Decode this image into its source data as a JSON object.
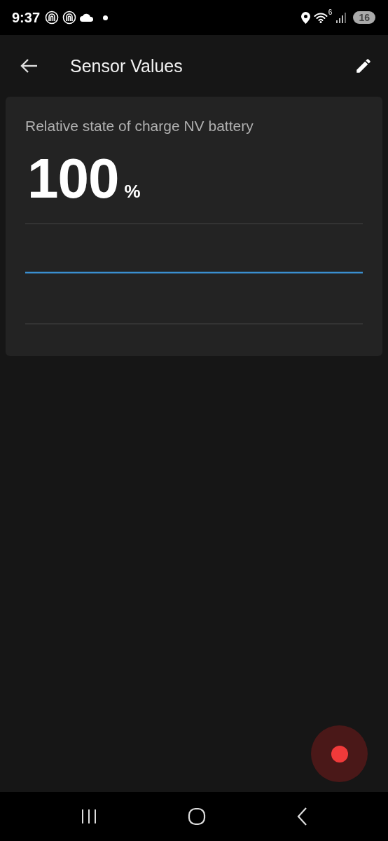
{
  "status_bar": {
    "time": "9:37",
    "wifi_badge": "6",
    "battery": "16"
  },
  "app_bar": {
    "title": "Sensor Values"
  },
  "sensor_card": {
    "label": "Relative state of charge NV battery",
    "value": "100",
    "unit": "%"
  }
}
